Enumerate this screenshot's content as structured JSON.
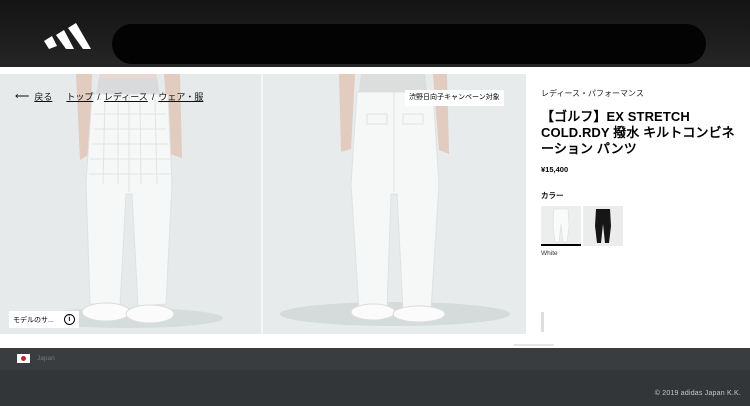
{
  "header": {
    "logo": "adidas-logo-icon",
    "search": ""
  },
  "gallery": {
    "breadcrumb": {
      "back": "戻る",
      "items": [
        "トップ",
        "レディース",
        "ウェア・服"
      ],
      "separator": "/"
    },
    "campaign_badge": "渋野日向子キャンペーン対象",
    "model_info": "モデルのサ..."
  },
  "product": {
    "category": "レディース・パフォーマンス",
    "title": "【ゴルフ】EX STRETCH COLD.RDY 撥水 キルトコンビネーション パンツ",
    "price": "¥15,400",
    "color_label": "カラー",
    "selected_color": "White",
    "colors": [
      "White",
      "Black"
    ]
  },
  "footer": {
    "country": "Japan",
    "copyright": "© 2019 adidas Japan K.K."
  },
  "colors": {
    "header_bg": "#1a1a1a",
    "gallery_bg": "#e6eaeb",
    "footer_bg": "#333638"
  }
}
